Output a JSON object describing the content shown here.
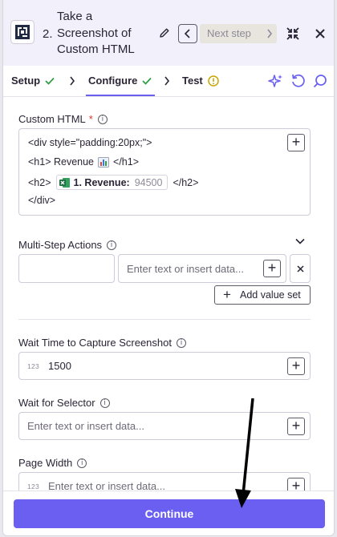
{
  "header": {
    "step_number": "2.",
    "step_title": "Take a Screenshot of Custom HTML",
    "next_step_label": "Next step"
  },
  "tabs": {
    "setup": "Setup",
    "configure": "Configure",
    "test": "Test"
  },
  "custom_html": {
    "label": "Custom HTML",
    "required_mark": "*",
    "lines": {
      "line1": "<div style=\"padding:20px;\">",
      "line2_prefix": "<h1> Revenue",
      "line2_suffix": "</h1>",
      "line3_prefix": "<h2>",
      "pill_label": "1. Revenue:",
      "pill_value": "94500",
      "line3_suffix": "</h2>",
      "line4": "</div>"
    }
  },
  "multi_step": {
    "label": "Multi-Step Actions",
    "value_placeholder": "Enter text or insert data...",
    "add_value_set": "Add value set"
  },
  "wait_time": {
    "label": "Wait Time to Capture Screenshot",
    "type_hint": "123",
    "value": "1500"
  },
  "wait_selector": {
    "label": "Wait for Selector",
    "placeholder": "Enter text or insert data..."
  },
  "page_width": {
    "label": "Page Width",
    "type_hint": "123",
    "placeholder": "Enter text or insert data..."
  },
  "footer": {
    "continue_label": "Continue"
  },
  "colors": {
    "accent": "#6a5ff0",
    "success": "#2f9e44",
    "warning": "#c9a400",
    "required": "#d93a2f"
  }
}
